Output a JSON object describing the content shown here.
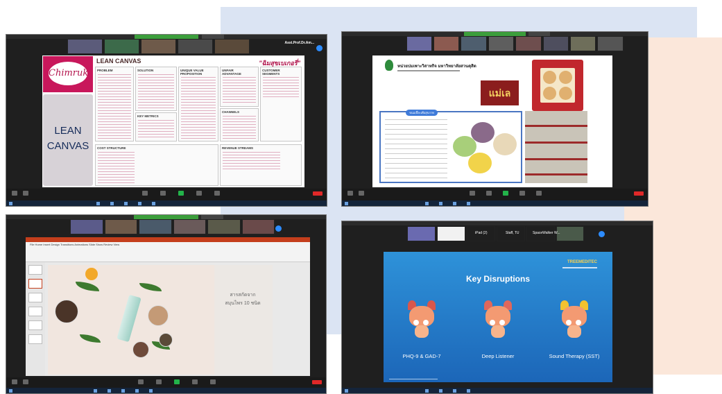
{
  "screen1": {
    "brand": "Chimruk",
    "sidebar_text": [
      "LEAN",
      "CANVAS"
    ],
    "canvas_title": "LEAN CANVAS",
    "thai_title": "\"ฉิมสุขเบเกอรี่\"",
    "boxes": {
      "problem": "PROBLEM",
      "solution": "SOLUTION",
      "uvp": "UNIQUE VALUE PROPOSITION",
      "unfair": "UNFAIR ADVANTAGE",
      "segments": "CUSTOMER SEGMENTS",
      "metrics": "KEY METRICS",
      "channels": "CHANNELS",
      "cost": "COST STRUCTURE",
      "revenue": "REVENUE STREAMS"
    },
    "participant_chip": "Asst.Prof.Dr.Am..."
  },
  "screen2": {
    "title": "หน่วยบ่มเพาะวิสาหกิจ มหาวิทยาลัยสวนดุสิต",
    "brand": "แม่เล",
    "panel_head": "ขนมเปี๊ยะเพื่อสุขภาพ"
  },
  "screen3": {
    "ribbon_tabs": "File  Home  Insert  Design  Transitions  Animations  Slide Show  Review  View",
    "slide_text": [
      "สารสกัดจาก",
      "สมุนไพร 10 ชนิด"
    ]
  },
  "screen4": {
    "names": [
      "iPad (2)",
      "Staff, TU",
      "SpaceWalker W..."
    ],
    "title": "Key Disruptions",
    "brand": "TREEMEDITEC",
    "labels": [
      "PHQ-9 & GAD-7",
      "Deep Listener",
      "Sound Therapy (SST)"
    ]
  },
  "colors": {
    "deco_blue": "#dbe4f3",
    "deco_peach": "#fbe7da",
    "lean_pink": "#c8175b",
    "slide_blue": "#1c66b8"
  }
}
